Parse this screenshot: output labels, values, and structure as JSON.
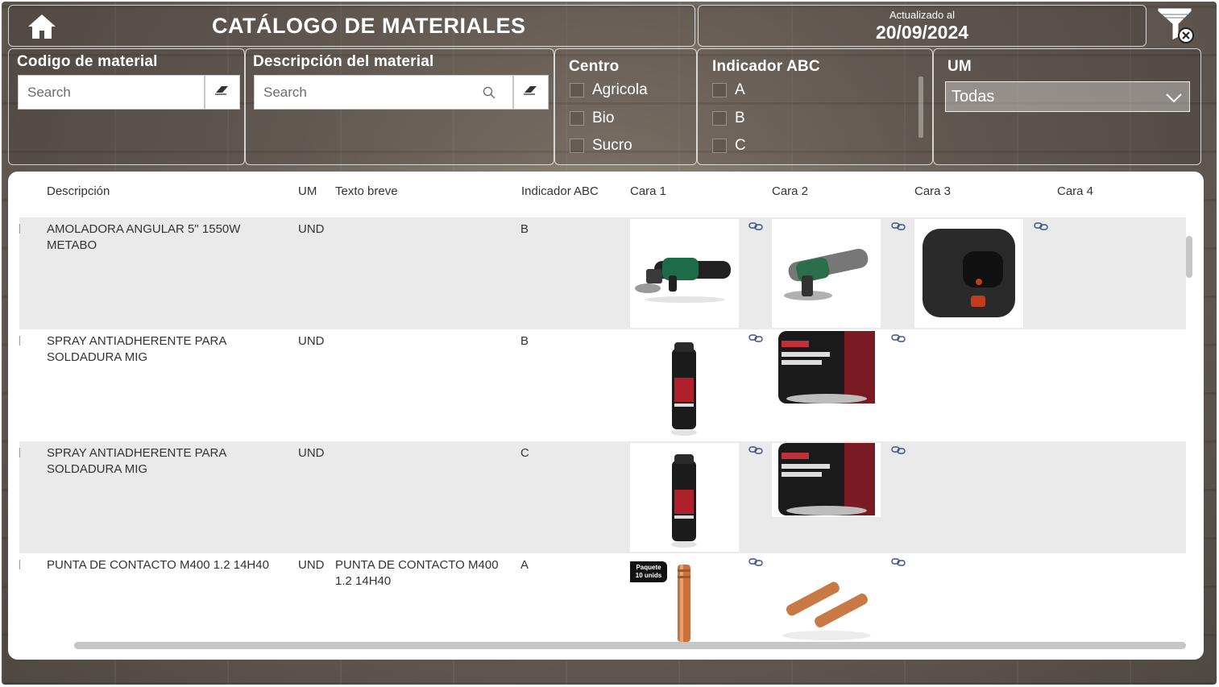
{
  "header": {
    "title": "CATÁLOGO DE MATERIALES",
    "date_caption": "Actualizado al",
    "date_value": "20/09/2024"
  },
  "filters": {
    "codigo": {
      "label": "Codigo de material",
      "placeholder": "Search"
    },
    "descripcion": {
      "label": "Descripción del material",
      "placeholder": "Search"
    },
    "centro": {
      "label": "Centro",
      "options": [
        "Agricola",
        "Bio",
        "Sucro"
      ]
    },
    "abc": {
      "label": "Indicador ABC",
      "options": [
        "A",
        "B",
        "C"
      ]
    },
    "um": {
      "label": "UM",
      "selected": "Todas"
    }
  },
  "table": {
    "columns": [
      "Descripción",
      "UM",
      "Texto breve",
      "Indicador ABC",
      "Cara 1",
      "Cara 2",
      "Cara 3",
      "Cara 4"
    ],
    "rows": [
      {
        "descripcion": "AMOLADORA ANGULAR 5\" 1550W METABO",
        "um": "UND",
        "texto_breve": "",
        "abc": "B",
        "images": [
          "angle-grinder-front",
          "angle-grinder-angled",
          "angle-grinder-rear"
        ]
      },
      {
        "descripcion": "SPRAY ANTIADHERENTE PARA SOLDADURA MIG",
        "um": "UND",
        "texto_breve": "",
        "abc": "B",
        "images": [
          "spray-can-small",
          "spray-can-label"
        ]
      },
      {
        "descripcion": "SPRAY ANTIADHERENTE PARA SOLDADURA MIG",
        "um": "UND",
        "texto_breve": "",
        "abc": "C",
        "images": [
          "spray-can-small",
          "spray-can-label"
        ]
      },
      {
        "descripcion": "PUNTA DE CONTACTO M400 1.2 14H40",
        "um": "UND",
        "texto_breve": "PUNTA DE CONTACTO M400 1.2 14H40",
        "abc": "A",
        "images": [
          "contact-tip-single",
          "contact-tips-pair"
        ],
        "badge": [
          "Paquete",
          "10 unids"
        ]
      }
    ]
  },
  "colors": {
    "title_text": "#ffffff",
    "table_bg": "#ffffff",
    "row_shade": "#ebeaea",
    "link_icon": "#3a4f8c",
    "scrollbar": "#c6c6c6"
  },
  "icons": [
    "home-icon",
    "clear-filters-icon",
    "search-icon",
    "eraser-icon",
    "chevron-down-icon",
    "link-icon"
  ]
}
